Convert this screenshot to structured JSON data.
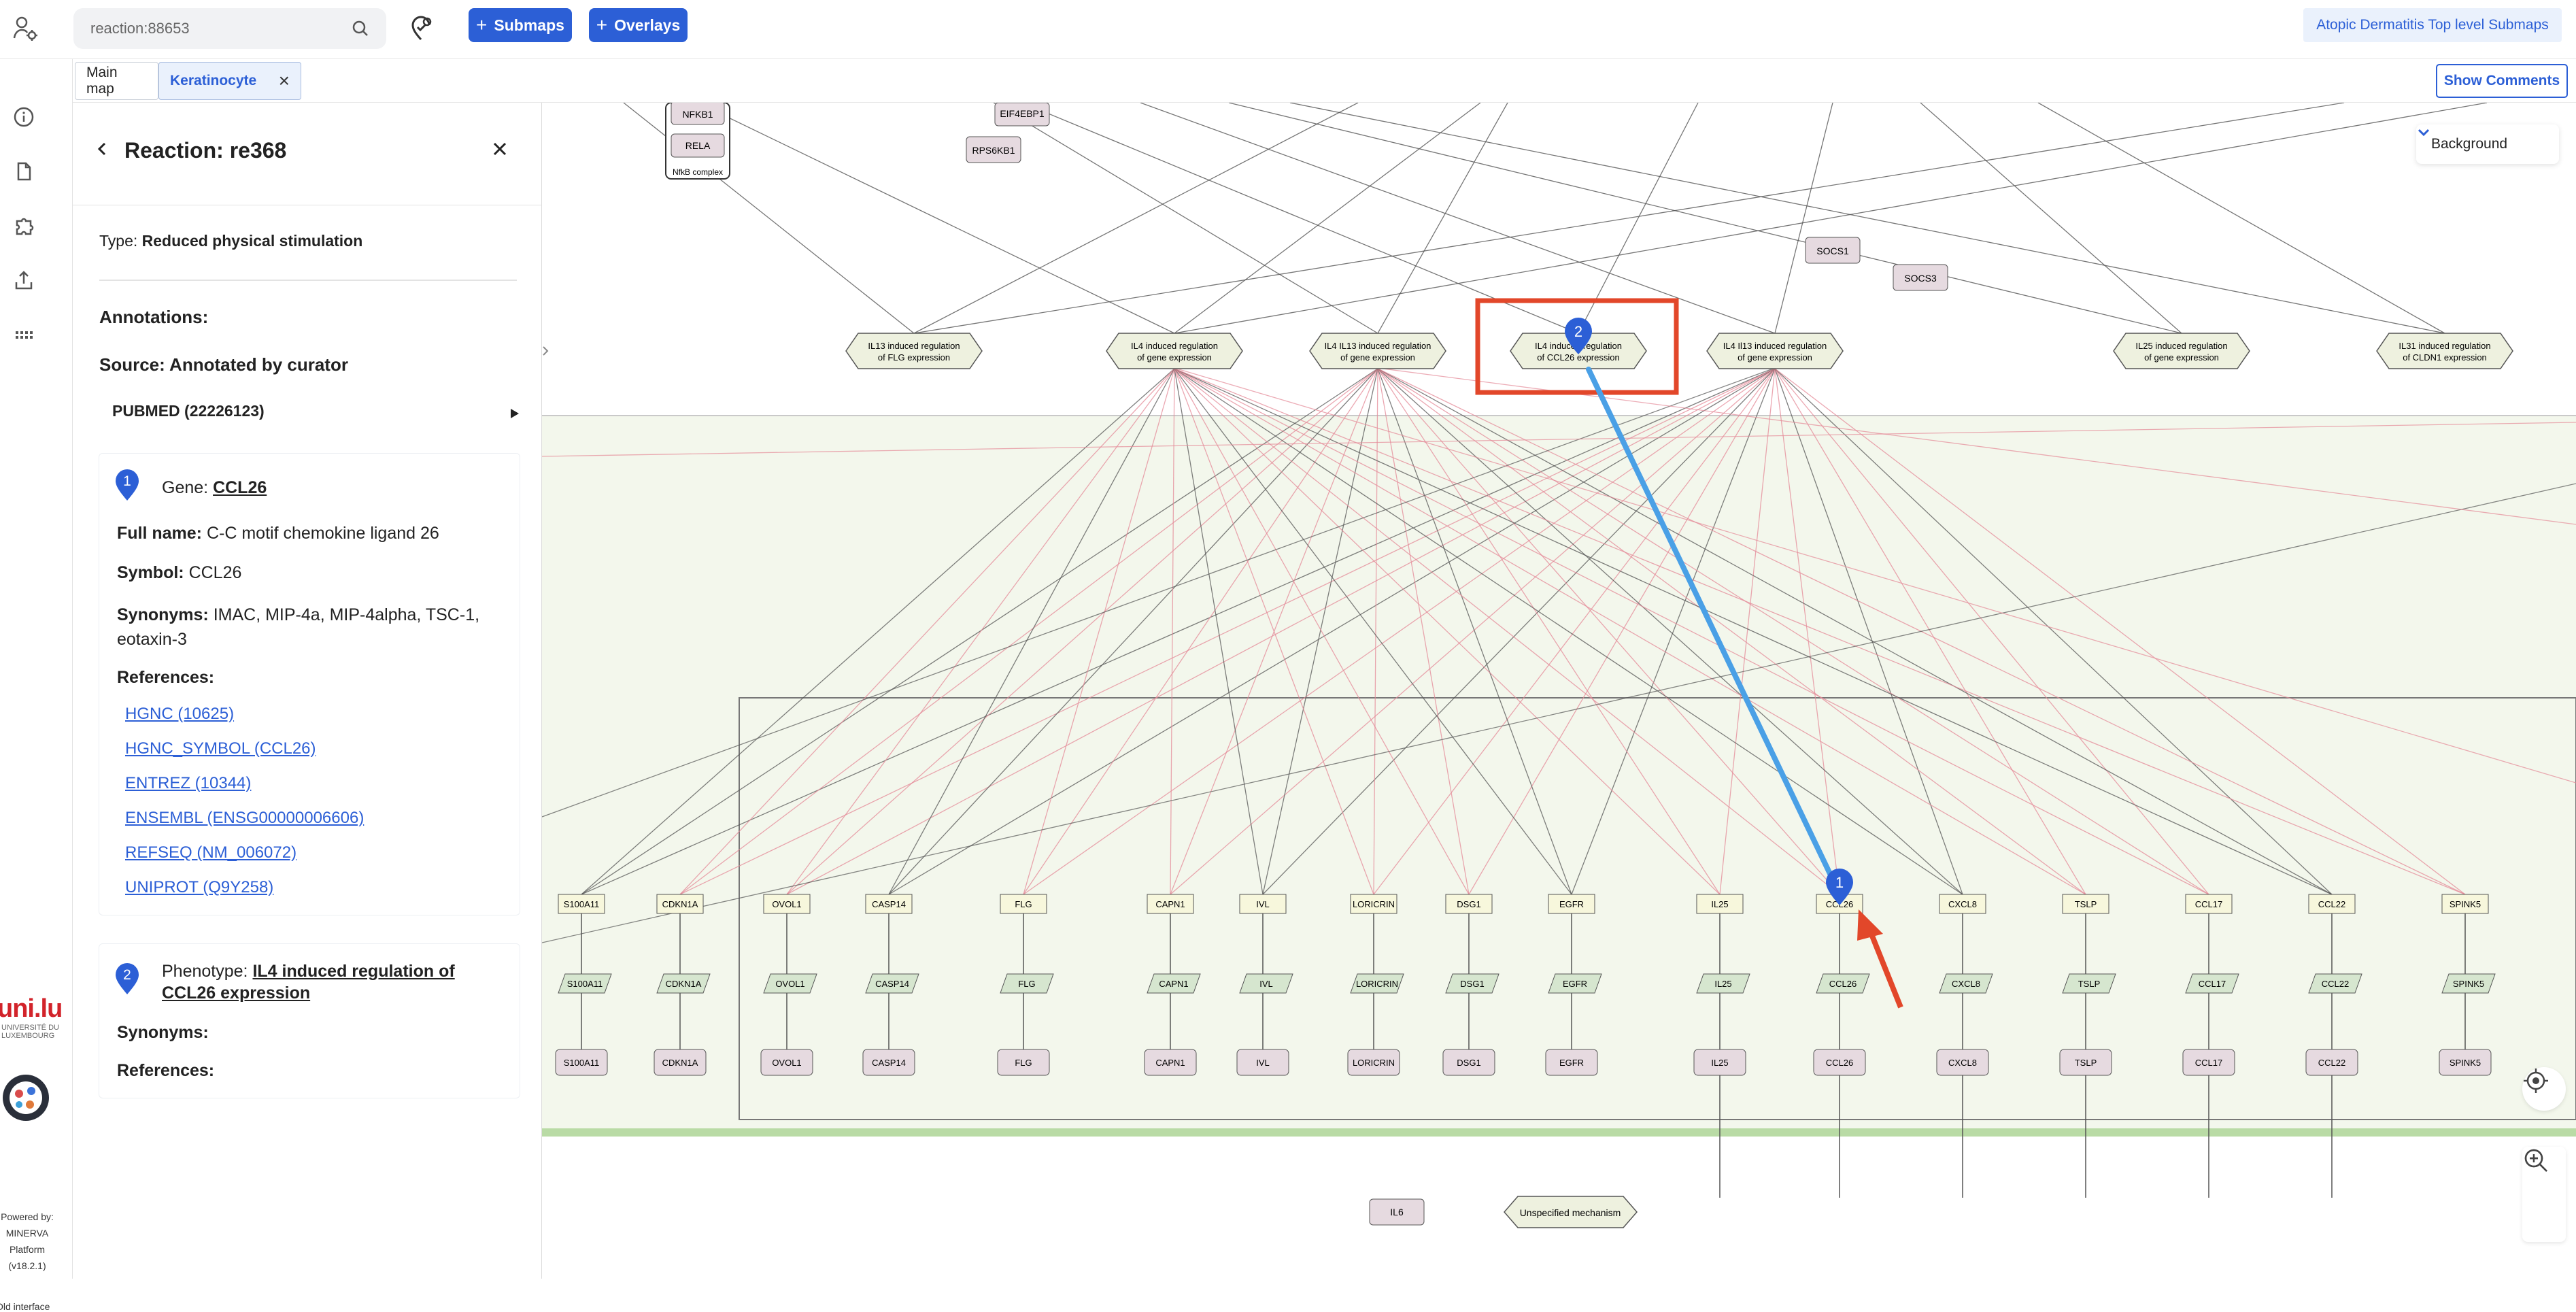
{
  "header": {
    "search_value": "reaction:88653",
    "submaps_label": "Submaps",
    "overlays_label": "Overlays",
    "top_level_submaps_label": "Atopic Dermatitis Top level Submaps"
  },
  "tabs": [
    {
      "label": "Main map",
      "active": false
    },
    {
      "label": "Keratinocyte",
      "active": true
    }
  ],
  "show_comments_label": "Show Comments",
  "background_label": "Background",
  "leftnav": {
    "logo_text": "uni.lu",
    "university_line1": "UNIVERSITÉ DU",
    "university_line2": "LUXEMBOURG",
    "powered_by": "Powered by:",
    "platform_name": "MINERVA",
    "platform_word": "Platform",
    "version": "(v18.2.1)",
    "old_interface": "Old interface"
  },
  "panel": {
    "title": "Reaction: re368",
    "type_label": "Type:",
    "type_value": "Reduced physical stimulation",
    "annotations_label": "Annotations:",
    "source_label": "Source: Annotated by curator",
    "pubmed_label": "PUBMED (22226123)",
    "gene": {
      "pin_number": "1",
      "prefix": "Gene:",
      "name": "CCL26",
      "full_name_label": "Full name:",
      "full_name_value": "C-C motif chemokine ligand 26",
      "symbol_label": "Symbol:",
      "symbol_value": "CCL26",
      "synonyms_label": "Synonyms:",
      "synonyms_value_line1": "IMAC, MIP-4a, MIP-4alpha, TSC-1,",
      "synonyms_value_line2": "eotaxin-3",
      "references_label": "References:",
      "references": [
        "HGNC (10625)",
        "HGNC_SYMBOL (CCL26)",
        "ENTREZ (10344)",
        "ENSEMBL (ENSG00000006606)",
        "REFSEQ (NM_006072)",
        "UNIPROT (Q9Y258)"
      ]
    },
    "phenotype": {
      "pin_number": "2",
      "prefix": "Phenotype:",
      "name_line1": "IL4 induced regulation of",
      "name_line2": "CCL26 expression",
      "synonyms_label": "Synonyms:",
      "references_label": "References:"
    }
  },
  "map": {
    "top_nodes": [
      "NFKB1",
      "RELA",
      "NfkB complex",
      "EIF4EBP1",
      "RPS6KB1",
      "SOCS1",
      "SOCS3"
    ],
    "phenotypes": [
      {
        "line1": "IL13 induced regulation",
        "line2": "of FLG expression"
      },
      {
        "line1": "IL4 induced regulation",
        "line2": "of gene expression"
      },
      {
        "line1": "IL4 IL13 induced regulation",
        "line2": "of gene expression"
      },
      {
        "line1": "IL4 induced regulation",
        "line2": "of CCL26 expression"
      },
      {
        "line1": "IL4 Il13 induced regulation",
        "line2": "of gene expression"
      },
      {
        "line1": "IL25 induced regulation",
        "line2": "of gene expression"
      },
      {
        "line1": "IL31 induced regulation",
        "line2": "of CLDN1 expression"
      }
    ],
    "genes": [
      "S100A11",
      "CDKN1A",
      "OVOL1",
      "CASP14",
      "FLG",
      "CAPN1",
      "IVL",
      "LORICRIN",
      "DSG1",
      "EGFR",
      "IL25",
      "CCL26",
      "CXCL8",
      "TSLP",
      "CCL17",
      "CCL22",
      "SPINK5"
    ],
    "extra_nodes": [
      "IL6",
      "Unspecified mechanism"
    ],
    "pin_1": "1",
    "pin_2": "2"
  }
}
